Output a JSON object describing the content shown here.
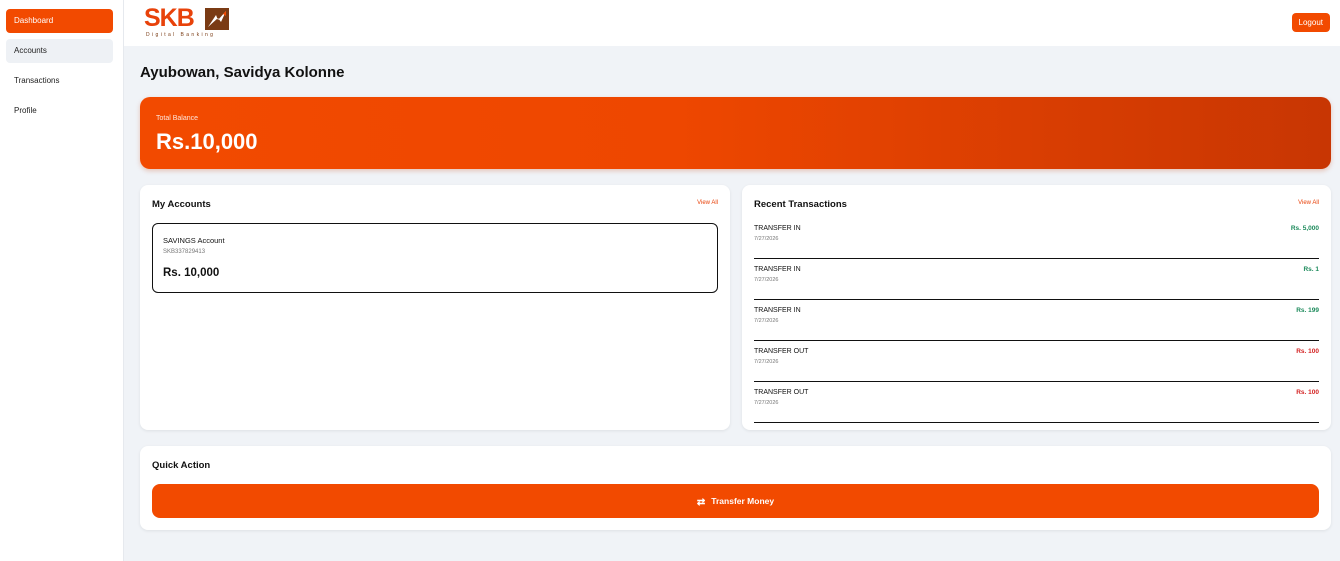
{
  "sidebar": {
    "items": [
      {
        "label": "Dashboard"
      },
      {
        "label": "Accounts"
      },
      {
        "label": "Transactions"
      },
      {
        "label": "Profile"
      }
    ]
  },
  "header": {
    "logo_text": "SKB",
    "logo_subtitle": "Digital Banking",
    "logout_label": "Logout"
  },
  "greeting": "Ayubowan, Savidya Kolonne",
  "balance": {
    "label": "Total Balance",
    "value": "Rs.10,000"
  },
  "accounts": {
    "title": "My Accounts",
    "view_all": "View All",
    "items": [
      {
        "type": "SAVINGS Account",
        "number": "SKB337829413",
        "balance": "Rs. 10,000"
      }
    ]
  },
  "transactions": {
    "title": "Recent Transactions",
    "view_all": "View All",
    "items": [
      {
        "type": "TRANSFER IN",
        "date": "7/27/2026",
        "amount": "Rs. 5,000",
        "direction": "in"
      },
      {
        "type": "TRANSFER IN",
        "date": "7/27/2026",
        "amount": "Rs. 1",
        "direction": "in"
      },
      {
        "type": "TRANSFER IN",
        "date": "7/27/2026",
        "amount": "Rs. 199",
        "direction": "in"
      },
      {
        "type": "TRANSFER OUT",
        "date": "7/27/2026",
        "amount": "Rs. 100",
        "direction": "out"
      },
      {
        "type": "TRANSFER OUT",
        "date": "7/27/2026",
        "amount": "Rs. 100",
        "direction": "out"
      }
    ]
  },
  "quick_action": {
    "title": "Quick Action",
    "transfer_label": "Transfer Money",
    "transfer_icon": "swap-arrows-icon"
  },
  "colors": {
    "accent": "#f24a00",
    "credit": "#1c8a5b",
    "debit": "#d32222"
  }
}
